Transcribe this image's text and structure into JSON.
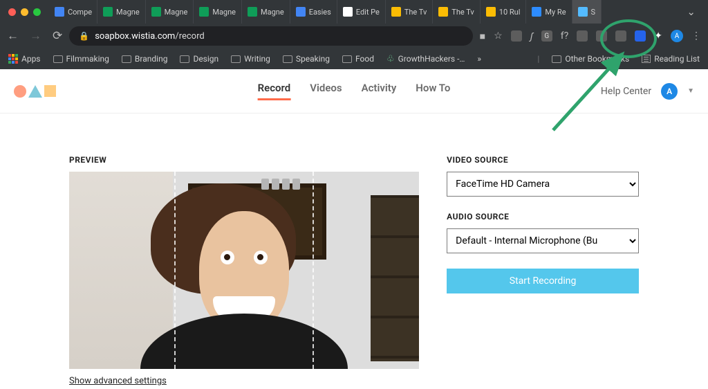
{
  "browser": {
    "tabs": [
      {
        "label": "Compe",
        "type": "docs"
      },
      {
        "label": "Magne",
        "type": "sheets"
      },
      {
        "label": "Magne",
        "type": "sheets"
      },
      {
        "label": "Magne",
        "type": "sheets"
      },
      {
        "label": "Magne",
        "type": "sheets"
      },
      {
        "label": "Easies",
        "type": "docs"
      },
      {
        "label": "Edit Pe",
        "type": "wp"
      },
      {
        "label": "The Tv",
        "type": "chrome"
      },
      {
        "label": "The Tv",
        "type": "chrome"
      },
      {
        "label": "10 Rul",
        "type": "chrome"
      },
      {
        "label": "My Re",
        "type": "zoom"
      },
      {
        "label": "S",
        "type": "wistia",
        "active": true
      }
    ],
    "url_host": "soapbox.wistia.com",
    "url_path": "/record",
    "bookmarks_bar": {
      "apps": "Apps",
      "items": [
        "Filmmaking",
        "Branding",
        "Design",
        "Writing",
        "Speaking",
        "Food"
      ],
      "growth": "GrowthHackers -…",
      "overflow": "»",
      "other": "Other Bookmarks",
      "reading": "Reading List"
    }
  },
  "nav": {
    "links": [
      "Record",
      "Videos",
      "Activity",
      "How To"
    ],
    "active_index": 0,
    "help": "Help Center",
    "avatar_letter": "A"
  },
  "record": {
    "preview_label": "PREVIEW",
    "advanced": "Show advanced settings",
    "video_label": "VIDEO SOURCE",
    "video_value": "FaceTime HD Camera",
    "audio_label": "AUDIO SOURCE",
    "audio_value": "Default - Internal Microphone (Bu",
    "start": "Start Recording"
  }
}
